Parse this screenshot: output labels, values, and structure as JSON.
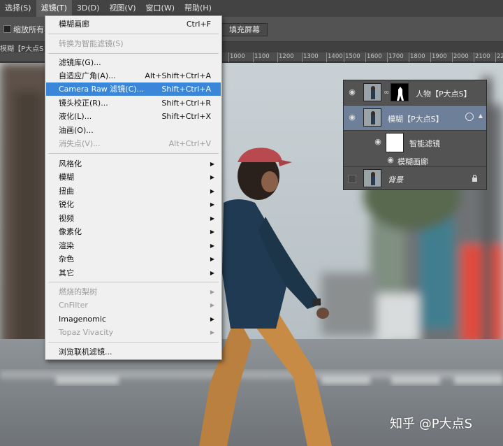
{
  "menubar": {
    "items": [
      "选择(S)",
      "滤镜(T)",
      "3D(D)",
      "视图(V)",
      "窗口(W)",
      "帮助(H)"
    ],
    "active_index": 1
  },
  "options": {
    "checkbox_label": "缩放所有",
    "fill_screen_label": "填充屏幕"
  },
  "doc_tab": {
    "title": "模糊【P大点S"
  },
  "ruler": {
    "ticks": [
      "1000",
      "1100",
      "1200",
      "1300",
      "1400",
      "1500",
      "1600",
      "1700",
      "1800",
      "1900",
      "2000",
      "2100",
      "2200",
      "23"
    ]
  },
  "filter_menu": {
    "items": [
      {
        "label": "模糊画廊",
        "shortcut": "Ctrl+F",
        "state": "normal"
      },
      {
        "type": "separator"
      },
      {
        "label": "转换为智能滤镜(S)",
        "state": "disabled"
      },
      {
        "type": "separator"
      },
      {
        "label": "滤镜库(G)...",
        "state": "normal"
      },
      {
        "label": "自适应广角(A)...",
        "shortcut": "Alt+Shift+Ctrl+A",
        "state": "normal"
      },
      {
        "label": "Camera Raw 滤镜(C)...",
        "shortcut": "Shift+Ctrl+A",
        "state": "highlight"
      },
      {
        "label": "镜头校正(R)...",
        "shortcut": "Shift+Ctrl+R",
        "state": "normal"
      },
      {
        "label": "液化(L)...",
        "shortcut": "Shift+Ctrl+X",
        "state": "normal"
      },
      {
        "label": "油画(O)...",
        "state": "normal"
      },
      {
        "label": "消失点(V)...",
        "shortcut": "Alt+Ctrl+V",
        "state": "disabled"
      },
      {
        "type": "separator"
      },
      {
        "label": "风格化",
        "submenu": true,
        "state": "normal"
      },
      {
        "label": "模糊",
        "submenu": true,
        "state": "normal"
      },
      {
        "label": "扭曲",
        "submenu": true,
        "state": "normal"
      },
      {
        "label": "锐化",
        "submenu": true,
        "state": "normal"
      },
      {
        "label": "视频",
        "submenu": true,
        "state": "normal"
      },
      {
        "label": "像素化",
        "submenu": true,
        "state": "normal"
      },
      {
        "label": "渲染",
        "submenu": true,
        "state": "normal"
      },
      {
        "label": "杂色",
        "submenu": true,
        "state": "normal"
      },
      {
        "label": "其它",
        "submenu": true,
        "state": "normal"
      },
      {
        "type": "separator"
      },
      {
        "label": "燃烧的梨树",
        "submenu": true,
        "state": "disabled"
      },
      {
        "label": "CnFilter",
        "submenu": true,
        "state": "disabled"
      },
      {
        "label": "Imagenomic",
        "submenu": true,
        "state": "normal"
      },
      {
        "label": "Topaz Vivacity",
        "submenu": true,
        "state": "disabled"
      },
      {
        "type": "separator"
      },
      {
        "label": "浏览联机滤镜...",
        "state": "normal"
      }
    ]
  },
  "layers": {
    "person": {
      "name": "人物【P大点S】"
    },
    "blur": {
      "name": "模糊【P大点S】"
    },
    "smart_filters": {
      "name": "智能滤镜"
    },
    "blur_gallery": {
      "name": "模糊画廊"
    },
    "background": {
      "name": "背景"
    }
  },
  "watermark": {
    "text": "知乎 @P大点S"
  },
  "colors": {
    "highlight": "#3a86d8",
    "menu_bg": "#f0f0f0",
    "selected_layer": "#6e7f99"
  }
}
